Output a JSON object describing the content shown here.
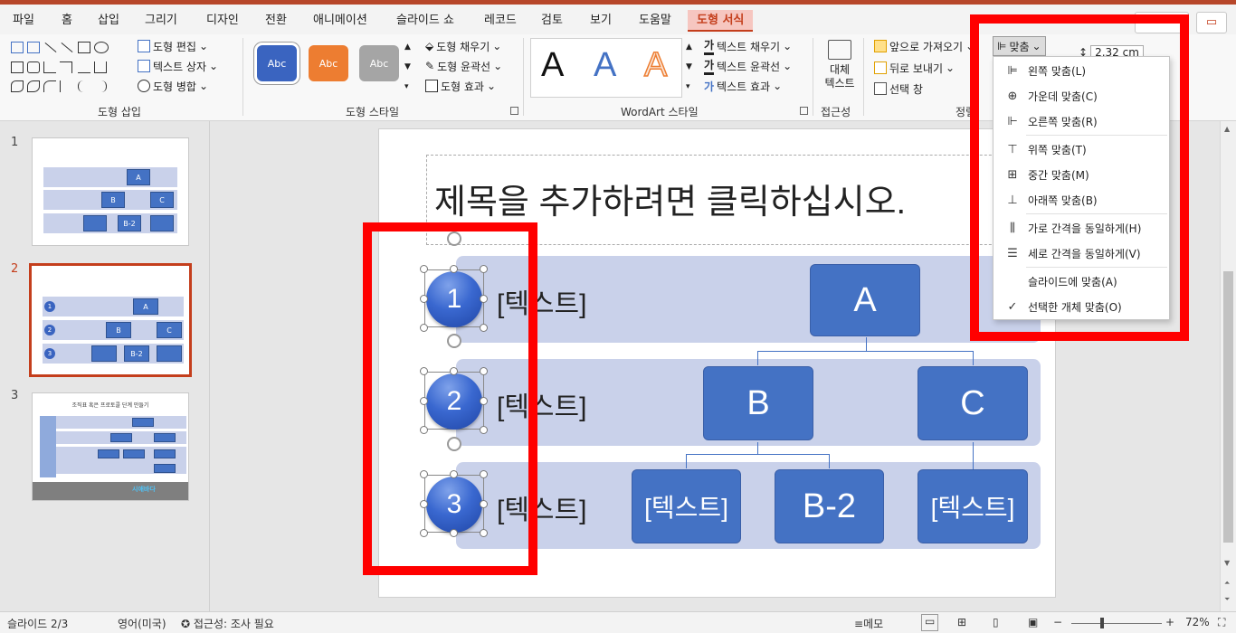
{
  "menu": {
    "tabs": [
      "파일",
      "홈",
      "삽입",
      "그리기",
      "디자인",
      "전환",
      "애니메이션",
      "슬라이드 쇼",
      "레코드",
      "검토",
      "보기",
      "도움말",
      "도형 서식"
    ]
  },
  "ribbon": {
    "insert_shapes": {
      "edit_shape": "도형 편집",
      "text_box": "텍스트 상자",
      "merge_shapes": "도형 병합",
      "label": "도형 삽입"
    },
    "shape_styles": {
      "swatch_label": "Abc",
      "fill": "도형 채우기",
      "outline": "도형 윤곽선",
      "effects": "도형 효과",
      "label": "도형 스타일"
    },
    "wordart": {
      "letter": "A",
      "text_fill": "텍스트 채우기",
      "text_outline": "텍스트 윤곽선",
      "text_effects": "텍스트 효과",
      "label": "WordArt 스타일",
      "icon_glyph": "가"
    },
    "accessibility": {
      "alt_text": "대체 텍스트",
      "label": "접근성"
    },
    "arrange": {
      "bring_forward": "앞으로 가져오기",
      "send_backward": "뒤로 보내기",
      "selection_pane": "선택 창",
      "align": "맞춤",
      "label_partial": "정렬"
    },
    "size": {
      "height": "2.32 cm"
    }
  },
  "align_menu": {
    "items": [
      {
        "icon": "⊫",
        "label": "왼쪽 맞춤(L)"
      },
      {
        "icon": "⊕",
        "label": "가운데 맞춤(C)"
      },
      {
        "icon": "⊩",
        "label": "오른쪽 맞춤(R)"
      },
      {
        "icon": "⊤",
        "label": "위쪽 맞춤(T)"
      },
      {
        "icon": "⊞",
        "label": "중간 맞춤(M)"
      },
      {
        "icon": "⊥",
        "label": "아래쪽 맞춤(B)"
      },
      {
        "icon": "⫼",
        "label": "가로 간격을 동일하게(H)"
      },
      {
        "icon": "☰",
        "label": "세로 간격을 동일하게(V)"
      },
      {
        "icon": "",
        "label": "슬라이드에 맞춤(A)"
      },
      {
        "icon": "✓",
        "label": "선택한 개체 맞춤(O)"
      }
    ]
  },
  "thumbnails": {
    "numbers": [
      "1",
      "2",
      "3"
    ],
    "slide3_title": "조직표 혹은 프로토콜 단계 만들기",
    "slide3_brand": "시애바다"
  },
  "slide": {
    "title": "제목을 추가하려면 클릭하십시오.",
    "steps": [
      "1",
      "2",
      "3"
    ],
    "step_text": "[텍스트]",
    "boxes": {
      "a": "A",
      "b": "B",
      "c": "C",
      "b2": "B-2",
      "text": "[텍스트]"
    }
  },
  "status": {
    "slide": "슬라이드 2/3",
    "language": "영어(미국)",
    "accessibility": "접근성: 조사 필요",
    "notes": "메모",
    "zoom": "72%"
  }
}
